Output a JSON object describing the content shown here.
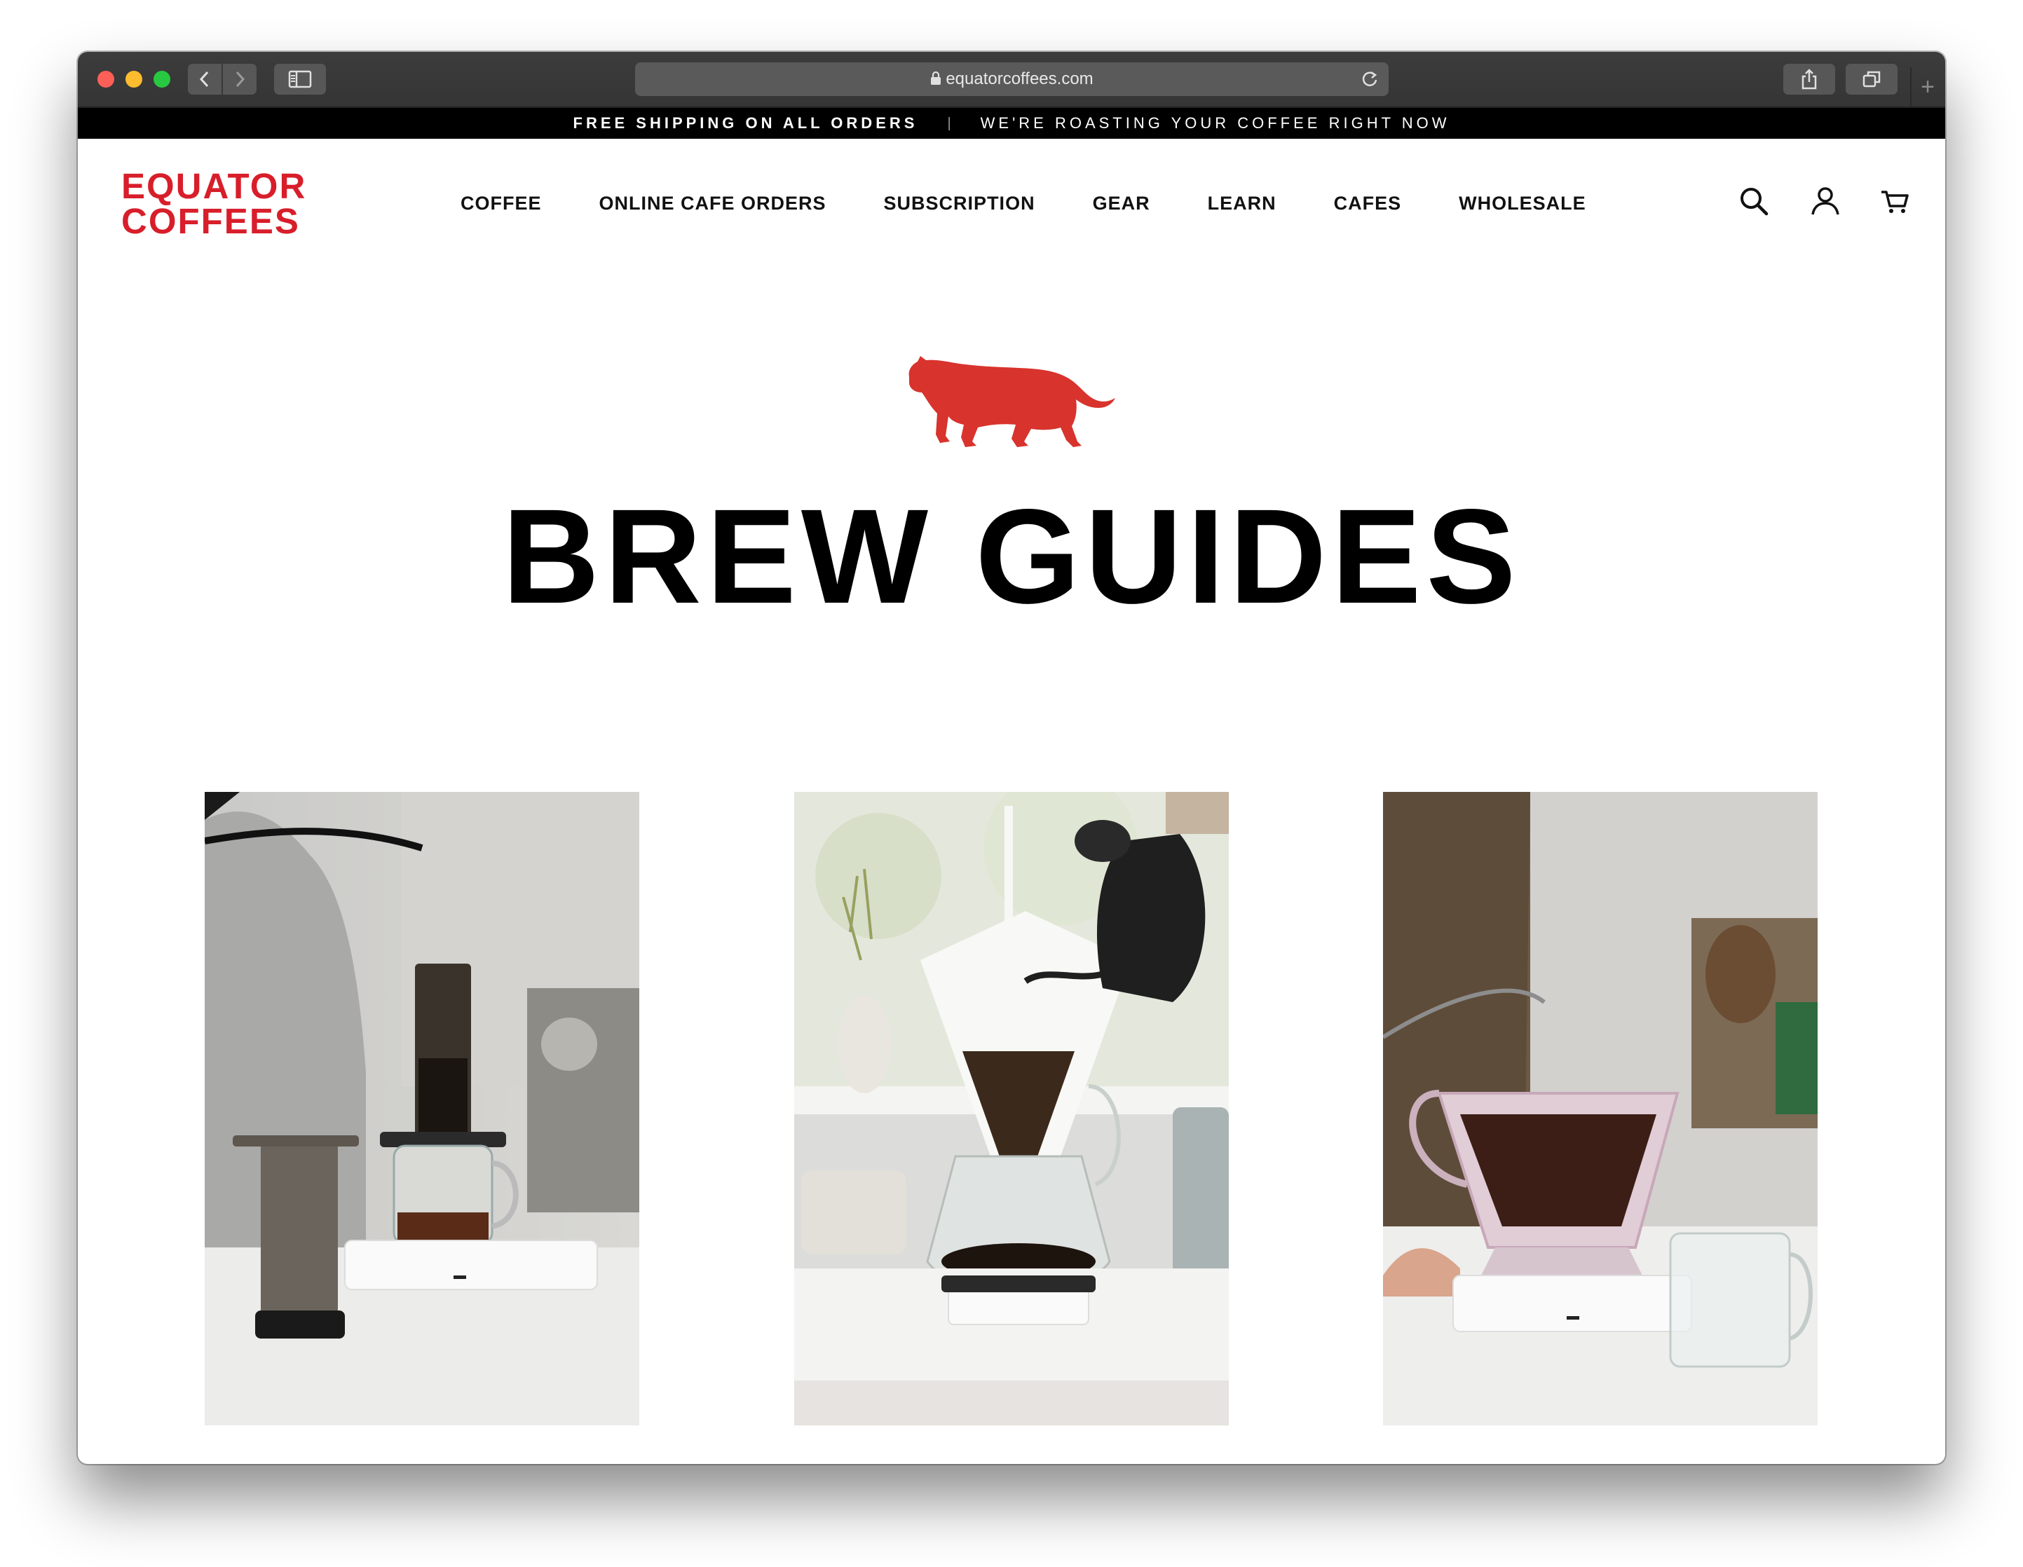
{
  "browser": {
    "url": "equatorcoffees.com",
    "icons": [
      "back-icon",
      "forward-icon",
      "sidebar-icon",
      "lock-icon",
      "reload-icon",
      "share-icon",
      "tabs-icon",
      "new-tab-icon"
    ],
    "new_tab_label": "+"
  },
  "promo": {
    "left": "FREE SHIPPING ON ALL ORDERS",
    "separator": "|",
    "right": "WE'RE ROASTING YOUR COFFEE RIGHT NOW"
  },
  "header": {
    "logo_line1": "EQUATOR",
    "logo_line2": "COFFEES",
    "nav": [
      "COFFEE",
      "ONLINE CAFE ORDERS",
      "SUBSCRIPTION",
      "GEAR",
      "LEARN",
      "CAFES",
      "WHOLESALE"
    ],
    "icons": [
      "search-icon",
      "account-icon",
      "cart-icon"
    ]
  },
  "colors": {
    "brand_red": "#d81e2a",
    "promo_bg": "#000000"
  },
  "main": {
    "mascot": "jaguar-logo",
    "title": "BREW GUIDES",
    "guides": [
      {
        "image": "aeropress-photo"
      },
      {
        "image": "chemex-photo"
      },
      {
        "image": "clever-dripper-photo"
      }
    ]
  }
}
